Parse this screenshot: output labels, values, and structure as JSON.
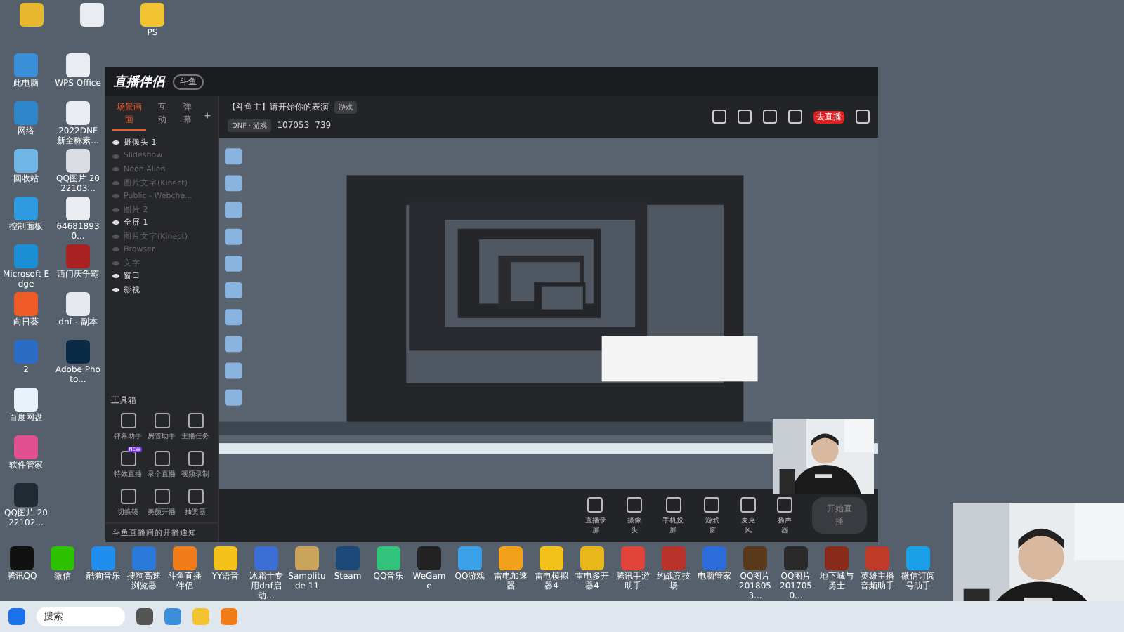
{
  "desktop": {
    "top_icons": [
      {
        "color": "#e8b730"
      },
      {
        "color": "#e9edf2"
      },
      {
        "label": "PS",
        "color": "#f1c232"
      }
    ],
    "left_icons": [
      {
        "label": "此电脑",
        "color": "#3a8fd8"
      },
      {
        "label": "网络",
        "color": "#2f86c9"
      },
      {
        "label": "回收站",
        "color": "#6fb6e6"
      },
      {
        "label": "控制面板",
        "color": "#2e9ae0"
      },
      {
        "label": "Microsoft Edge",
        "color": "#1b8fd6"
      },
      {
        "label": "向日葵",
        "color": "#f05a28"
      },
      {
        "label": "2",
        "color": "#2b6cc4"
      },
      {
        "label": "百度网盘",
        "color": "#e9f1fb"
      },
      {
        "label": "软件管家",
        "color": "#e04f8f"
      },
      {
        "label": "QQ图片 2022102...",
        "color": "#1f2a33"
      },
      {
        "label": "WPS Office",
        "color": "#e9edf2"
      },
      {
        "label": "2022DNF新全称素...",
        "color": "#e9edf2"
      },
      {
        "label": "QQ图片 2022103...",
        "color": "#d9dde3"
      },
      {
        "label": "646818930...",
        "color": "#e9edf2"
      },
      {
        "label": "西门庆争霸",
        "color": "#a82222"
      },
      {
        "label": "dnf - 副本",
        "color": "#e6e9ee"
      },
      {
        "label": "Adobe Photo...",
        "color": "#0b2a45"
      }
    ],
    "bottom_icons": [
      {
        "label": "腾讯QQ",
        "color": "#111111"
      },
      {
        "label": "微信",
        "color": "#2dc100"
      },
      {
        "label": "酷狗音乐",
        "color": "#1f8ef0"
      },
      {
        "label": "搜狗高速浏览器",
        "color": "#2a78d8"
      },
      {
        "label": "斗鱼直播伴侣",
        "color": "#f07d1a"
      },
      {
        "label": "YY语音",
        "color": "#f4c21a"
      },
      {
        "label": "冰霜士专用dnf启动...",
        "color": "#3d6ed6"
      },
      {
        "label": "Samplitude 11",
        "color": "#c9a45a"
      },
      {
        "label": "Steam",
        "color": "#1b4a78"
      },
      {
        "label": "QQ音乐",
        "color": "#31c27c"
      },
      {
        "label": "WeGame",
        "color": "#222222"
      },
      {
        "label": "QQ游戏",
        "color": "#3aa0e8"
      },
      {
        "label": "雷电加速器",
        "color": "#f2a21a"
      },
      {
        "label": "雷电模拟器4",
        "color": "#f2c21a"
      },
      {
        "label": "雷电多开器4",
        "color": "#e8b71a"
      },
      {
        "label": "腾讯手游助手",
        "color": "#e0443a"
      },
      {
        "label": "约战竞技场",
        "color": "#b8322a"
      },
      {
        "label": "电脑管家",
        "color": "#2b6cd8"
      },
      {
        "label": "QQ图片 2018053...",
        "color": "#5a3a1a"
      },
      {
        "label": "QQ图片 2017050...",
        "color": "#2a2a2a"
      },
      {
        "label": "地下城与勇士",
        "color": "#8a2a1a"
      },
      {
        "label": "英雄主播音频助手",
        "color": "#c03a2a"
      },
      {
        "label": "微信订阅号助手",
        "color": "#1aa0e8"
      }
    ]
  },
  "app": {
    "logo": "直播伴侣",
    "version": "斗鱼",
    "tabs": [
      {
        "label": "场景画面",
        "selected": true
      },
      {
        "label": "互动",
        "selected": false
      },
      {
        "label": "弹幕",
        "selected": false
      }
    ],
    "add": "+",
    "sources": [
      {
        "label": "摄像头 1",
        "visible": true
      },
      {
        "label": "Slideshow",
        "visible": false
      },
      {
        "label": "Neon Alien",
        "visible": false
      },
      {
        "label": "图片文字(Kinect)",
        "visible": false
      },
      {
        "label": "Public - Webcha...",
        "visible": false
      },
      {
        "label": "图片 2",
        "visible": false
      },
      {
        "label": "全屏 1",
        "visible": true
      },
      {
        "label": "图片文字(Kinect)",
        "visible": false
      },
      {
        "label": "Browser",
        "visible": false
      },
      {
        "label": "文字",
        "visible": false
      },
      {
        "label": "窗口",
        "visible": true
      },
      {
        "label": "影视",
        "visible": true
      }
    ],
    "toolbox_title": "工具箱",
    "tools": [
      {
        "label": "弹幕助手"
      },
      {
        "label": "房管助手"
      },
      {
        "label": "主播任务"
      },
      {
        "label": "特效直播",
        "badge": "NEW"
      },
      {
        "label": "录个直播"
      },
      {
        "label": "视频录制"
      },
      {
        "label": "切换镜"
      },
      {
        "label": "美颜开播"
      },
      {
        "label": "抽奖器"
      }
    ],
    "notice": "斗鱼直播间的开播通知",
    "room_title": "【斗鱼主】请开始你的表演",
    "room_tag": "游戏",
    "category": "DNF · 游戏",
    "room_id": "107053",
    "followers": "739",
    "live_badge": "去直播",
    "controls": [
      {
        "label": "直播录屏"
      },
      {
        "label": "摄像头"
      },
      {
        "label": "手机投屏"
      },
      {
        "label": "游戏窗"
      },
      {
        "label": "麦克风"
      },
      {
        "label": "扬声器"
      }
    ],
    "start": "开始直播"
  },
  "taskbar": {
    "search": "搜索"
  }
}
